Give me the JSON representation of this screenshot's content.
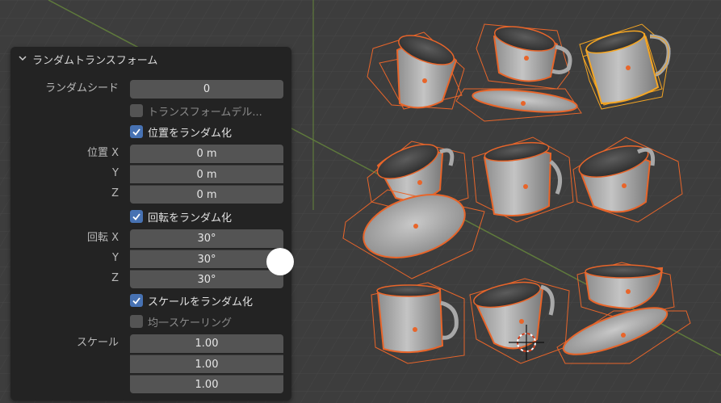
{
  "panel": {
    "title": "ランダムトランスフォーム",
    "seed_label": "ランダムシード",
    "seed_value": "0",
    "delta_label": "トランスフォームデル...",
    "location_checkbox": "位置をランダム化",
    "location": {
      "label": "位置 X",
      "y_label": "Y",
      "z_label": "Z",
      "x": "0 m",
      "y": "0 m",
      "z": "0 m"
    },
    "rotation_checkbox": "回転をランダム化",
    "rotation": {
      "label": "回転 X",
      "y_label": "Y",
      "z_label": "Z",
      "x": "30°",
      "y": "30°",
      "z": "30°"
    },
    "scale_checkbox": "スケールをランダム化",
    "uniform_label": "均一スケーリング",
    "scale": {
      "label": "スケール",
      "x": "1.00",
      "y": "1.00",
      "z": "1.00"
    }
  },
  "colors": {
    "viewport_bg": "#3d3d3d",
    "panel_bg": "#232323",
    "field_bg": "#545454",
    "checkbox_on": "#4772b3",
    "selection_orange": "#e8652a",
    "active_yellow": "#f5a623"
  },
  "icons": [
    "chevron-down-icon",
    "checkmark-icon",
    "3d-cursor-icon"
  ]
}
